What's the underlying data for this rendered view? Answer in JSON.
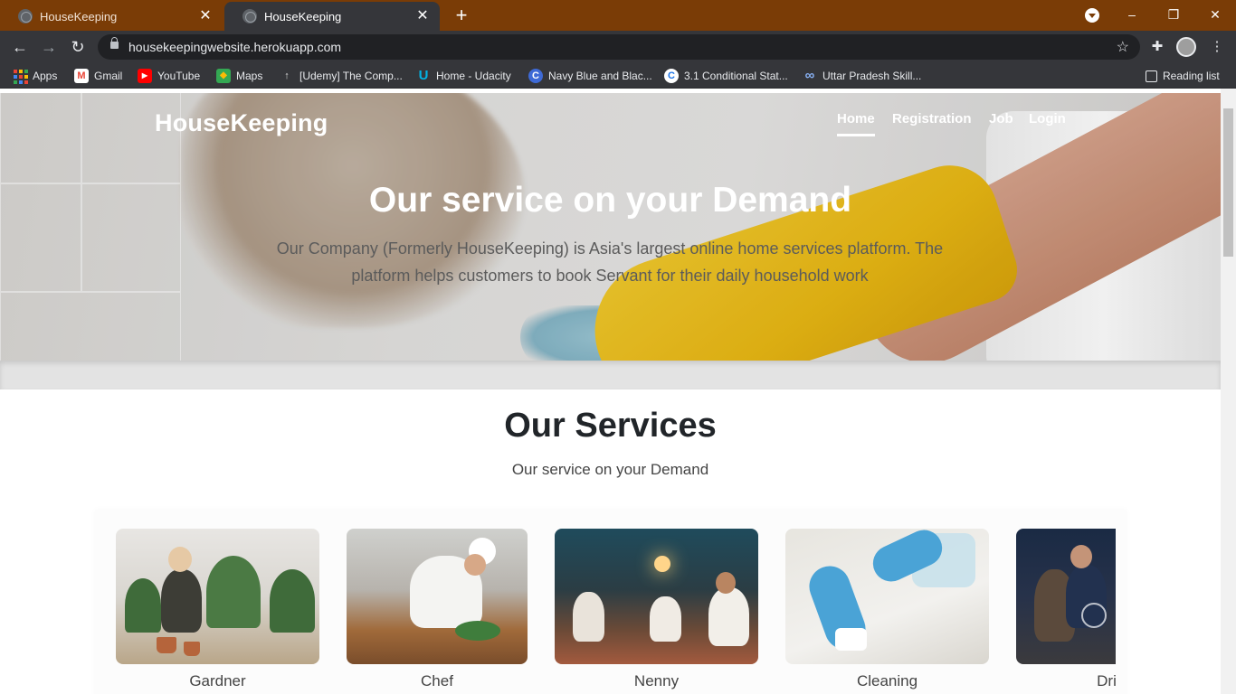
{
  "browser": {
    "tabs": [
      {
        "title": "HouseKeeping",
        "active": false
      },
      {
        "title": "HouseKeeping",
        "active": true
      }
    ],
    "new_tab_label": "+",
    "url": "housekeepingwebsite.herokuapp.com",
    "window_controls": {
      "minimize": "–",
      "restore": "❐",
      "close": "✕"
    },
    "bookmarks": [
      {
        "label": "Apps",
        "icon": "apps-grid-icon"
      },
      {
        "label": "Gmail",
        "icon": "gmail-icon",
        "color": "#ea4335",
        "glyph": "M"
      },
      {
        "label": "YouTube",
        "icon": "youtube-icon",
        "color": "#ff0000",
        "glyph": "▶"
      },
      {
        "label": "Maps",
        "icon": "maps-icon",
        "color": "#34a853",
        "glyph": "◆"
      },
      {
        "label": "[Udemy] The Comp...",
        "icon": "udemy-icon",
        "color": "#a435f0",
        "glyph": "↑"
      },
      {
        "label": "Home - Udacity",
        "icon": "udacity-icon",
        "color": "#02b3e4",
        "glyph": "U"
      },
      {
        "label": "Navy Blue and Blac...",
        "icon": "canva-icon",
        "color": "#00c4cc",
        "glyph": "C"
      },
      {
        "label": "3.1 Conditional Stat...",
        "icon": "codechef-icon",
        "color": "#1a73e8",
        "glyph": "C"
      },
      {
        "label": "Uttar Pradesh Skill...",
        "icon": "link-icon",
        "color": "#5f8dd3",
        "glyph": "∞"
      }
    ],
    "reading_list": "Reading list"
  },
  "site": {
    "brand": "HouseKeeping",
    "nav": [
      {
        "label": "Home",
        "active": true
      },
      {
        "label": "Registration",
        "active": false
      },
      {
        "label": "Job",
        "active": false
      },
      {
        "label": "Login",
        "active": false
      }
    ],
    "hero": {
      "title": "Our service on your Demand",
      "text": "Our Company (Formerly HouseKeeping) is Asia's largest online home services platform. The platform helps customers to book Servant for their daily household work"
    },
    "services": {
      "title": "Our Services",
      "subtitle": "Our service on your Demand",
      "cards": [
        {
          "label": "Gardner"
        },
        {
          "label": "Chef"
        },
        {
          "label": "Nenny"
        },
        {
          "label": "Cleaning"
        },
        {
          "label": "Dri"
        }
      ]
    }
  },
  "colors": {
    "tab_strip": "#7a3c06",
    "toolbar": "#35363a",
    "omnibox": "#202124",
    "heading_text": "#212529"
  }
}
